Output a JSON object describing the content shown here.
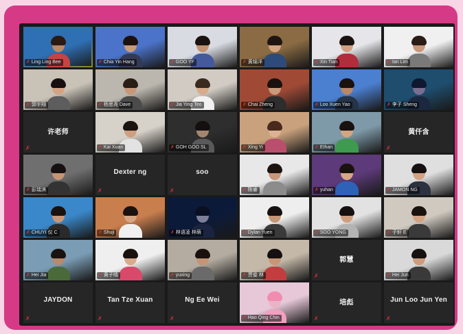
{
  "participants": [
    {
      "name": "Ling Ling Bee",
      "video": true,
      "active": true,
      "bg": "#2f6fb3",
      "skin": "#b9876a",
      "hair": "#2a1a12",
      "shirt": "#c84343"
    },
    {
      "name": "Chia Yin Hang",
      "video": true,
      "bg": "#4b73c9",
      "skin": "#c89b7e",
      "hair": "#1b120d",
      "shirt": "#343a56"
    },
    {
      "name": "GOO YF",
      "video": true,
      "bg": "#d8dbe2",
      "skin": "#c3916f",
      "hair": "#1a120e",
      "shirt": "#445a9c"
    },
    {
      "name": "黄锦洋",
      "video": true,
      "bg": "#8a6b43",
      "skin": "#d2a47f",
      "hair": "#1f1612",
      "shirt": "#2d4b7a"
    },
    {
      "name": "Xin Tian",
      "video": true,
      "bg": "#e6e6ea",
      "skin": "#d0a181",
      "hair": "#1a1210",
      "shirt": "#b12d3b"
    },
    {
      "name": "Ian Lim",
      "video": true,
      "bg": "#f0f0f0",
      "skin": "#c8987a",
      "hair": "#2a1d15",
      "shirt": "#7a7a7a"
    },
    {
      "name": "郭宇翔",
      "video": true,
      "bg": "#c9c2b7",
      "skin": "#d3a383",
      "hair": "#161010",
      "shirt": "#5d5d5d"
    },
    {
      "name": "杨思尧 Dave",
      "video": true,
      "bg": "#bcb7ae",
      "skin": "#c8977a",
      "hair": "#2a1e16",
      "shirt": "#4b4b4b"
    },
    {
      "name": "Jia Ying Teo",
      "video": true,
      "bg": "#d1cbc4",
      "skin": "#d7ab8c",
      "hair": "#3a2a20",
      "shirt": "#f2f2f2"
    },
    {
      "name": "Chai Zheng",
      "video": true,
      "bg": "#a04a36",
      "skin": "#c99a7c",
      "hair": "#1a120e",
      "shirt": "#2d2d2d"
    },
    {
      "name": "Loo Xuen Yao",
      "video": true,
      "bg": "#4b7fd0",
      "skin": "#b8876a",
      "hair": "#1a120e",
      "shirt": "#263448"
    },
    {
      "name": "李子 Sheng",
      "video": true,
      "bg": "#1e4d6e",
      "skin": "#7a6e90",
      "hair": "#0e1830",
      "shirt": "#1b2840"
    },
    {
      "name": "许老师",
      "video": false
    },
    {
      "name": "Kai Xuan",
      "video": true,
      "bg": "#d7d2c9",
      "skin": "#cf9f80",
      "hair": "#1b130f",
      "shirt": "#e2e2e2"
    },
    {
      "name": "GOH GOO SL",
      "video": true,
      "bg": "#2e2e2e",
      "skin": "#a48670",
      "hair": "#141010",
      "shirt": "#5a5a5a"
    },
    {
      "name": "Xing Yi",
      "video": true,
      "bg": "#c9a27d",
      "skin": "#deb196",
      "hair": "#4a2a1c",
      "shirt": "#b94f6d"
    },
    {
      "name": "Ethan",
      "video": true,
      "bg": "#7e9aa8",
      "skin": "#d3a585",
      "hair": "#1a120e",
      "shirt": "#3d9a4e"
    },
    {
      "name": "黄仟含",
      "video": false
    },
    {
      "name": "彭瑞淇",
      "video": true,
      "bg": "#6f6f6f",
      "skin": "#c69575",
      "hair": "#161010",
      "shirt": "#333333"
    },
    {
      "name": "Dexter ng",
      "video": false
    },
    {
      "name": "soo",
      "video": false
    },
    {
      "name": "陈睿",
      "video": true,
      "bg": "#e8e8e8",
      "skin": "#c89878",
      "hair": "#1c140f",
      "shirt": "#8c8c8c"
    },
    {
      "name": "yuhan",
      "video": true,
      "bg": "#5d3a7a",
      "skin": "#d7a888",
      "hair": "#1a120e",
      "shirt": "#2d62b8"
    },
    {
      "name": "JAMON NG",
      "video": true,
      "bg": "#dfdfdf",
      "skin": "#d2a283",
      "hair": "#161010",
      "shirt": "#2d3240"
    },
    {
      "name": "CHUYI 仪 C",
      "video": true,
      "bg": "#3a88c9",
      "skin": "#c8977a",
      "hair": "#1a120e",
      "shirt": "#2a2a2a"
    },
    {
      "name": "Shuji",
      "video": true,
      "bg": "#c97e4e",
      "skin": "#d6a684",
      "hair": "#1a120e",
      "shirt": "#f0f0f0"
    },
    {
      "name": "林语凌 林萌",
      "video": true,
      "bg": "#0c1a3a",
      "skin": "#7d7f98",
      "hair": "#0a0f22",
      "shirt": "#1a2440"
    },
    {
      "name": "Dylan Yuen",
      "video": true,
      "bg": "#eeeeee",
      "skin": "#c79676",
      "hair": "#161010",
      "shirt": "#3a3a3a"
    },
    {
      "name": "SOO YONG",
      "video": true,
      "bg": "#e2e2e2",
      "skin": "#cf9e7f",
      "hair": "#161010",
      "shirt": "#b3b3b3"
    },
    {
      "name": "子轩 E",
      "video": true,
      "bg": "#cfc9c0",
      "skin": "#d3a384",
      "hair": "#1a120e",
      "shirt": "#3a3a3a"
    },
    {
      "name": "Hei Jia",
      "video": true,
      "bg": "#7a9cb4",
      "skin": "#b58a6e",
      "hair": "#1a120e",
      "shirt": "#4a6a3a"
    },
    {
      "name": "黄子晴",
      "video": true,
      "bg": "#efefef",
      "skin": "#d7ab8c",
      "hair": "#1a120e",
      "shirt": "#d94a6a"
    },
    {
      "name": "yuxing",
      "video": true,
      "bg": "#b4aca1",
      "skin": "#c49474",
      "hair": "#1a120e",
      "shirt": "#6a6a6a"
    },
    {
      "name": "贾俊 林",
      "video": true,
      "bg": "#c4b8a8",
      "skin": "#c69676",
      "hair": "#161010",
      "shirt": "#c23d3d"
    },
    {
      "name": "郭慧",
      "video": false
    },
    {
      "name": "Hei Jun",
      "video": true,
      "bg": "#d9d9d9",
      "skin": "#cc9c7c",
      "hair": "#161010",
      "shirt": "#3a3a3a"
    },
    {
      "name": "JAYDON",
      "video": false
    },
    {
      "name": "Tan Tze Xuan",
      "video": false
    },
    {
      "name": "Ng Ee Wei",
      "video": false
    },
    {
      "name": "Hao Qing Chin",
      "video": true,
      "bg": "#e7c8d8",
      "skin": "#e8b4c6",
      "hair": "#f28bb0",
      "shirt": "#f2a0c0"
    },
    {
      "name": "培彪",
      "video": false
    },
    {
      "name": "Jun Loo Jun Yen",
      "video": false
    }
  ]
}
